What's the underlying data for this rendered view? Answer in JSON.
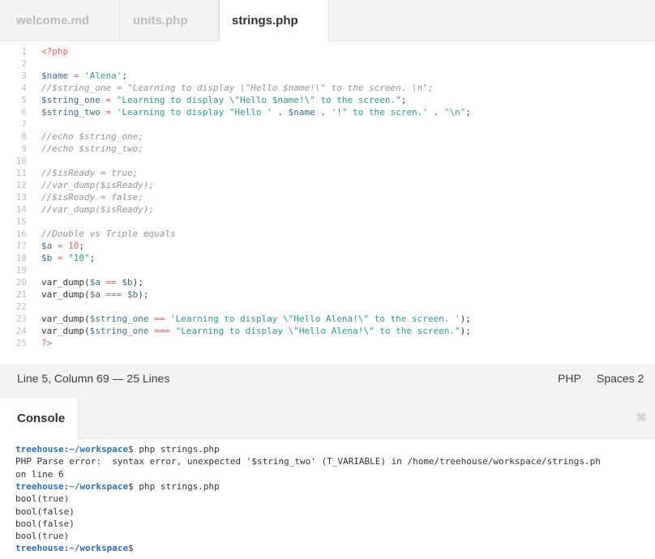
{
  "tabs": [
    {
      "label": "welcome.md",
      "active": false
    },
    {
      "label": "units.php",
      "active": false
    },
    {
      "label": "strings.php",
      "active": true
    }
  ],
  "editor": {
    "lines": [
      {
        "n": "1",
        "tokens": [
          [
            "tagc",
            "<?php"
          ]
        ]
      },
      {
        "n": "2",
        "tokens": []
      },
      {
        "n": "3",
        "tokens": [
          [
            "var",
            "$name"
          ],
          [
            "op",
            " = "
          ],
          [
            "str",
            "'Alena'"
          ],
          [
            "kw",
            ";"
          ]
        ]
      },
      {
        "n": "4",
        "tokens": [
          [
            "cmt",
            "//$string_one = \"Learning to display \\\"Hello $name!\\\" to the screen. \\n\";"
          ]
        ]
      },
      {
        "n": "5",
        "tokens": [
          [
            "var",
            "$string_one"
          ],
          [
            "op",
            " = "
          ],
          [
            "str",
            "\"Learning to display \\\"Hello $name!\\\" to the screen.\""
          ],
          [
            "kw",
            ";"
          ]
        ]
      },
      {
        "n": "6",
        "tokens": [
          [
            "var",
            "$string_two"
          ],
          [
            "op",
            " = "
          ],
          [
            "str",
            "'Learning to display \"Hello '"
          ],
          [
            "kw",
            " . "
          ],
          [
            "var",
            "$name"
          ],
          [
            "kw",
            " . "
          ],
          [
            "str",
            "'!\" to the scren.'"
          ],
          [
            "kw",
            " . "
          ],
          [
            "str",
            "\"\\n\""
          ],
          [
            "kw",
            ";"
          ]
        ]
      },
      {
        "n": "7",
        "tokens": []
      },
      {
        "n": "8",
        "tokens": [
          [
            "cmt",
            "//echo $string_one;"
          ]
        ]
      },
      {
        "n": "9",
        "tokens": [
          [
            "cmt",
            "//echo $string_two;"
          ]
        ]
      },
      {
        "n": "10",
        "tokens": []
      },
      {
        "n": "11",
        "tokens": [
          [
            "cmt",
            "//$isReady = true;"
          ]
        ]
      },
      {
        "n": "12",
        "tokens": [
          [
            "cmt",
            "//var_dump($isReady);"
          ]
        ]
      },
      {
        "n": "13",
        "tokens": [
          [
            "cmt",
            "//$isReady = false;"
          ]
        ]
      },
      {
        "n": "14",
        "tokens": [
          [
            "cmt",
            "//var_dump($isReady);"
          ]
        ]
      },
      {
        "n": "15",
        "tokens": []
      },
      {
        "n": "16",
        "tokens": [
          [
            "cmt",
            "//Double vs Triple equals"
          ]
        ]
      },
      {
        "n": "17",
        "tokens": [
          [
            "var",
            "$a"
          ],
          [
            "op",
            " = "
          ],
          [
            "num",
            "10"
          ],
          [
            "kw",
            ";"
          ]
        ]
      },
      {
        "n": "18",
        "tokens": [
          [
            "var",
            "$b"
          ],
          [
            "op",
            " = "
          ],
          [
            "str",
            "\"10\""
          ],
          [
            "kw",
            ";"
          ]
        ]
      },
      {
        "n": "19",
        "tokens": []
      },
      {
        "n": "20",
        "tokens": [
          [
            "kw",
            "var_dump("
          ],
          [
            "var",
            "$a"
          ],
          [
            "op",
            " == "
          ],
          [
            "var",
            "$b"
          ],
          [
            "kw",
            ");"
          ]
        ]
      },
      {
        "n": "21",
        "tokens": [
          [
            "kw",
            "var_dump("
          ],
          [
            "var",
            "$a"
          ],
          [
            "op",
            " === "
          ],
          [
            "var",
            "$b"
          ],
          [
            "kw",
            ");"
          ]
        ]
      },
      {
        "n": "22",
        "tokens": []
      },
      {
        "n": "23",
        "tokens": [
          [
            "kw",
            "var_dump("
          ],
          [
            "var",
            "$string_one"
          ],
          [
            "op",
            " == "
          ],
          [
            "str",
            "'Learning to display \\\"Hello Alena!\\\" to the screen. '"
          ],
          [
            "kw",
            ");"
          ]
        ]
      },
      {
        "n": "24",
        "tokens": [
          [
            "kw",
            "var_dump("
          ],
          [
            "var",
            "$string_one"
          ],
          [
            "op",
            " === "
          ],
          [
            "str",
            "\"Learning to display \\\"Hello Alena!\\\" to the screen.\""
          ],
          [
            "kw",
            ");"
          ]
        ]
      },
      {
        "n": "25",
        "tokens": [
          [
            "tagc",
            "?>"
          ]
        ]
      }
    ]
  },
  "status": {
    "position": "Line 5, Column 69 — 25 Lines",
    "language": "PHP",
    "spaces": "Spaces 2"
  },
  "console": {
    "title": "Console",
    "close_glyph": "✖",
    "lines": [
      {
        "type": "prompt",
        "user": "treehouse",
        "path": ":~/workspace",
        "cmd": "$ php strings.php"
      },
      {
        "type": "text",
        "text": "PHP Parse error:  syntax error, unexpected '$string_two' (T_VARIABLE) in /home/treehouse/workspace/strings.ph"
      },
      {
        "type": "text",
        "text": "on line 6"
      },
      {
        "type": "prompt",
        "user": "treehouse",
        "path": ":~/workspace",
        "cmd": "$ php strings.php"
      },
      {
        "type": "text",
        "text": "bool(true)"
      },
      {
        "type": "text",
        "text": "bool(false)"
      },
      {
        "type": "text",
        "text": "bool(false)"
      },
      {
        "type": "text",
        "text": "bool(true)"
      },
      {
        "type": "prompt",
        "user": "treehouse",
        "path": ":~/workspace",
        "cmd": "$"
      }
    ]
  }
}
